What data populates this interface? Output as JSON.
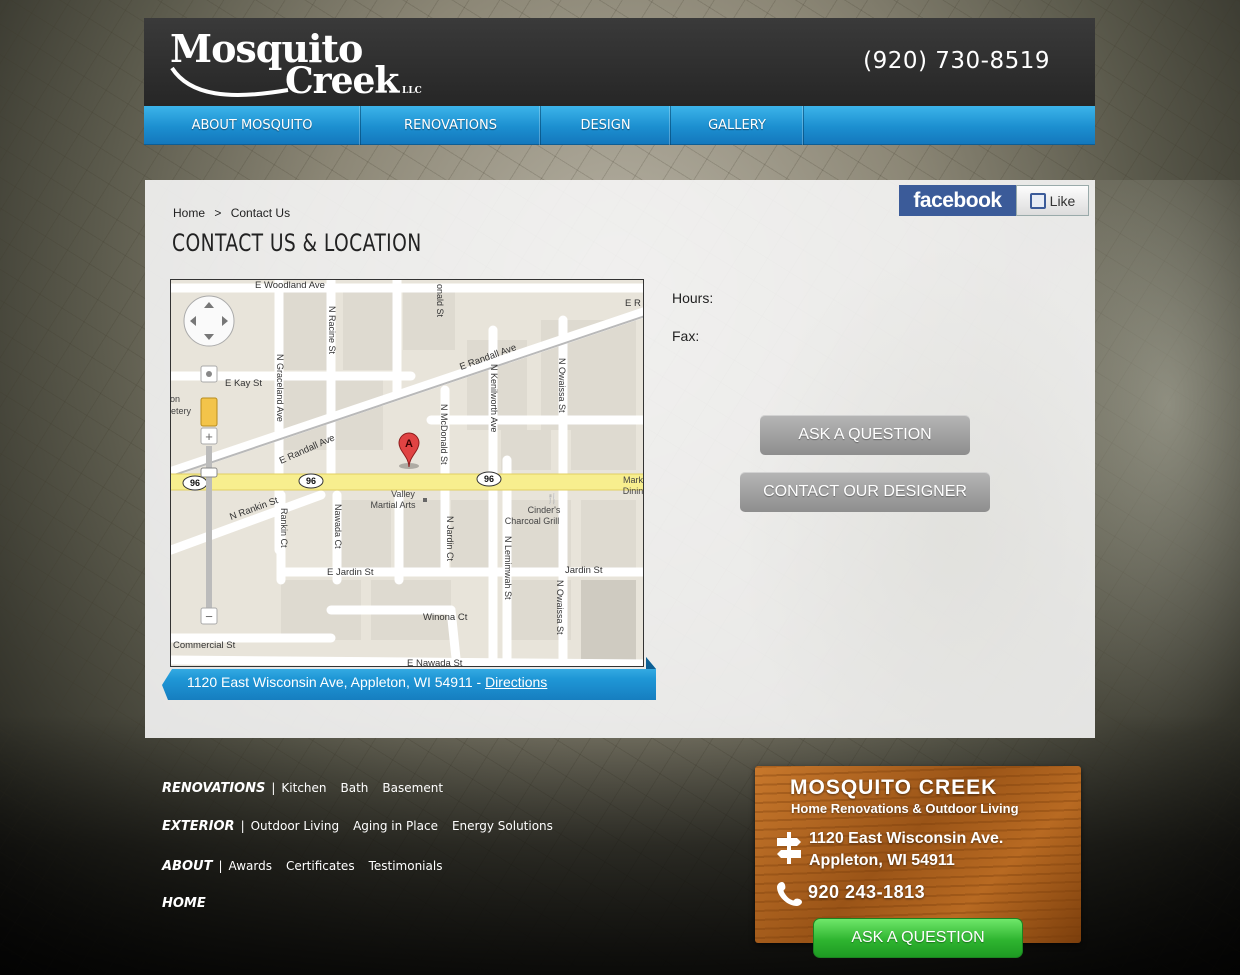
{
  "header": {
    "logo_line1": "Mosquito",
    "logo_line2": "Creek",
    "logo_llc": "LLC",
    "phone": "(920) 730-8519"
  },
  "nav": {
    "items": [
      {
        "label": "ABOUT MOSQUITO"
      },
      {
        "label": "RENOVATIONS"
      },
      {
        "label": "DESIGN"
      },
      {
        "label": "GALLERY"
      }
    ]
  },
  "social": {
    "facebook": "facebook",
    "like": "Like"
  },
  "breadcrumb": {
    "home": "Home",
    "separator": ">",
    "current": "Contact Us"
  },
  "page": {
    "title": "CONTACT US & LOCATION"
  },
  "map": {
    "streets": [
      "E Woodland Ave",
      "E Randall Ave",
      "E Kay St",
      "E Randall Ave",
      "N Rankin St",
      "E Jardin St",
      "Jardin St",
      "Commercial St",
      "Winona Ct",
      "E Nawada St",
      "E R"
    ],
    "vertical_streets": [
      "N Racine St",
      "N Graceland Ave",
      "onald St",
      "N Kenilworth Ave",
      "N Owaissa St",
      "N McDonald St",
      "Rankin Ct",
      "Nawada Ct",
      "N Jardin Ct",
      "N Lemimwah St",
      "N Owaissa St"
    ],
    "highway": "96",
    "places": [
      "Valley",
      "Martial Arts",
      "Cinder's",
      "Charcoal Grill",
      "Mark",
      "Dinin",
      "on",
      "etery"
    ],
    "marker": "A"
  },
  "address": {
    "text": "1120 East Wisconsin Ave, Appleton, WI 54911 - ",
    "directions": "Directions"
  },
  "info": {
    "hours_label": "Hours:",
    "fax_label": "Fax:"
  },
  "buttons": {
    "ask_question": "ASK A QUESTION",
    "contact_designer": "CONTACT OUR DESIGNER",
    "ask_question_green": "ASK A QUESTION"
  },
  "footer": {
    "rows": [
      {
        "heading": "RENOVATIONS",
        "links": [
          "Kitchen",
          "Bath",
          "Basement"
        ]
      },
      {
        "heading": "EXTERIOR",
        "links": [
          "Outdoor Living",
          "Aging in Place",
          "Energy Solutions"
        ]
      },
      {
        "heading": "ABOUT",
        "links": [
          "Awards",
          "Certificates",
          "Testimonials"
        ]
      },
      {
        "heading": "HOME",
        "links": []
      }
    ],
    "separator": "|"
  },
  "sign": {
    "title": "MOSQUITO CREEK",
    "subtitle": "Home Renovations & Outdoor Living",
    "address_line1": "1120 East Wisconsin Ave.",
    "address_line2": "Appleton, WI 54911",
    "phone": "920 243-1813"
  },
  "colors": {
    "nav_blue": "#1c8fd0",
    "facebook_blue": "#3b5b99",
    "button_gray": "#9e9e9e",
    "button_green": "#2fb530",
    "wood": "#a85e1c"
  }
}
